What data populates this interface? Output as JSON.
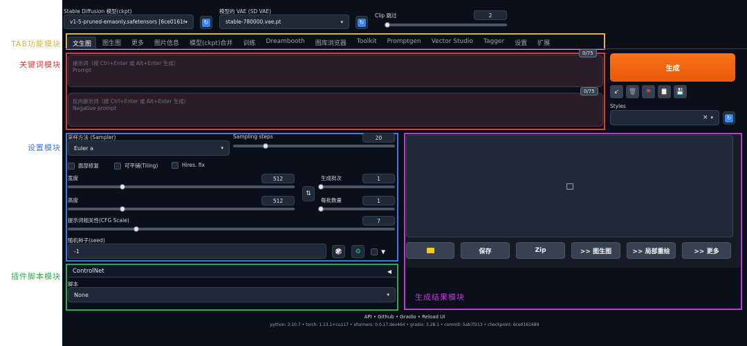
{
  "annotations": {
    "tab": "TAB功能模块",
    "keywords": "关键词模块",
    "settings": "设置模块",
    "plugins": "插件脚本模块",
    "results": "生成结果模块"
  },
  "colors": {
    "tab": "#e6b23a",
    "keywords": "#e53935",
    "settings": "#3f7be0",
    "plugins": "#2eab4d",
    "results": "#c03ad8",
    "generate": "#f97316"
  },
  "top": {
    "model_label": "Stable Diffusion 模型(ckpt)",
    "model_value": "v1-5-pruned-emaonly.safetensors [6ce0161689]",
    "vae_label": "模型的 VAE (SD VAE)",
    "vae_value": "stable-780000.vae.pt",
    "clip_label": "Clip 跳过",
    "clip_value": "2",
    "clip_level": 0.0
  },
  "tabs": [
    "文生图",
    "图生图",
    "更多",
    "图片信息",
    "模型(ckpt)合并",
    "训练",
    "Dreambooth",
    "图库浏览器",
    "Toolkit",
    "Promptgen",
    "Vector Studio",
    "Tagger",
    "设置",
    "扩展"
  ],
  "prompt": {
    "placeholder_line1": "提示词（按 Ctrl+Enter 或 Alt+Enter 生成）",
    "placeholder_line2": "Prompt",
    "counter": "0/75"
  },
  "negative": {
    "placeholder_line1": "反向提示词（按 Ctrl+Enter 或 Alt+Enter 生成）",
    "placeholder_line2": "Negative prompt",
    "counter": "0/75"
  },
  "generate": {
    "label": "生成",
    "styles_label": "Styles",
    "styles_clear": "×",
    "styles_caret": "▾"
  },
  "settings": {
    "sampler_label": "采样方法 (Sampler)",
    "sampler_value": "Euler a",
    "steps_label": "Sampling steps",
    "steps_value": "20",
    "steps_level": 0.2,
    "face_restore": "面部修复",
    "tiling": "可平铺(Tiling)",
    "hires": "Hires. fix",
    "width_label": "宽度",
    "width_value": "512",
    "width_level": 0.24,
    "height_label": "高度",
    "height_value": "512",
    "height_level": 0.24,
    "batch_count_label": "生成批次",
    "batch_count_value": "1",
    "batch_count_level": 0.0,
    "batch_size_label": "每批数量",
    "batch_size_value": "1",
    "batch_size_level": 0.0,
    "cfg_label": "提示词相关性(CFG Scale)",
    "cfg_value": "7",
    "cfg_level": 0.21,
    "seed_label": "随机种子(seed)",
    "seed_value": "-1",
    "swap_icon": "⇅",
    "dice_icon": "🎲",
    "recycle_icon": "♻",
    "extra_caret": "▼"
  },
  "plugins": {
    "controlnet": "ControlNet",
    "controlnet_arrow": "◀",
    "script_label": "脚本",
    "script_value": "None"
  },
  "results": {
    "buttons": [
      "保存",
      "Zip",
      ">> 图生图",
      ">> 局部重绘",
      ">> 更多"
    ]
  },
  "footer": {
    "links": "API  •  Github  •  Gradio  •  Reload UI",
    "versions": "python: 3.10.7  •  torch: 1.13.1+cu117  •  xformers: 0.0.17.dev464  •  gradio: 3.28.1  •  commit: 5ab7f213  •  checkpoint: 6ce0161689"
  }
}
